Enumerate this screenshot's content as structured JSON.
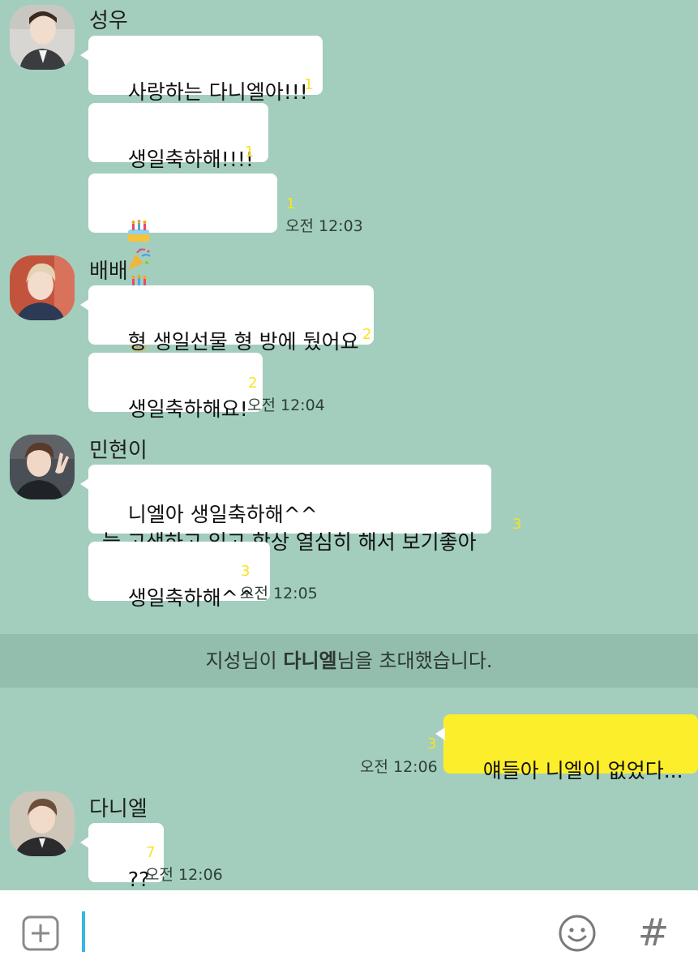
{
  "messages": [
    {
      "sender": "성우",
      "bubbles": [
        {
          "text": "사랑하는 다니엘아!!!",
          "unread": "1"
        },
        {
          "text": "생일축하해!!!!",
          "unread": "1"
        },
        {
          "icons": [
            "cake-icon",
            "party-popper-icon",
            "cake-icon",
            "firework-icon",
            "sparkler-icon",
            "party-popper-icon"
          ],
          "unread": "1",
          "time": "오전 12:03"
        }
      ]
    },
    {
      "sender": "배배",
      "bubbles": [
        {
          "text": "형 생일선물 형 방에 뒀어요",
          "unread": "2"
        },
        {
          "text": "생일축하해요!",
          "unread": "2",
          "time": "오전 12:04"
        }
      ]
    },
    {
      "sender": "민현이",
      "bubbles": [
        {
          "text": "니엘아 생일축하해^^\n늘 고생하고 있고 항상 열심히 해서 보기좋아",
          "unread": "3"
        },
        {
          "text": "생일축하해^^",
          "unread": "3",
          "time": "오전 12:05"
        }
      ]
    },
    {
      "system": {
        "part1": "지성님이 ",
        "bold": "다니엘",
        "part2": "님을 초대했습니다."
      }
    },
    {
      "sender": "me",
      "bubbles": [
        {
          "text": "얘들아 니엘이 없었다...",
          "unread": "3",
          "time": "오전 12:06"
        }
      ]
    },
    {
      "sender": "다니엘",
      "bubbles": [
        {
          "text": "??",
          "unread": "7",
          "time": "오전 12:06"
        }
      ]
    }
  ],
  "input_bar": {
    "icons": [
      "plus-icon",
      "emoticon-icon",
      "hashtag-icon"
    ],
    "hash_glyph": "#"
  },
  "colors": {
    "background": "#a3cebd",
    "my_bubble": "#fdee2b",
    "other_bubble": "#ffffff",
    "unread_count": "#f7e322",
    "caret": "#35b7e8"
  }
}
